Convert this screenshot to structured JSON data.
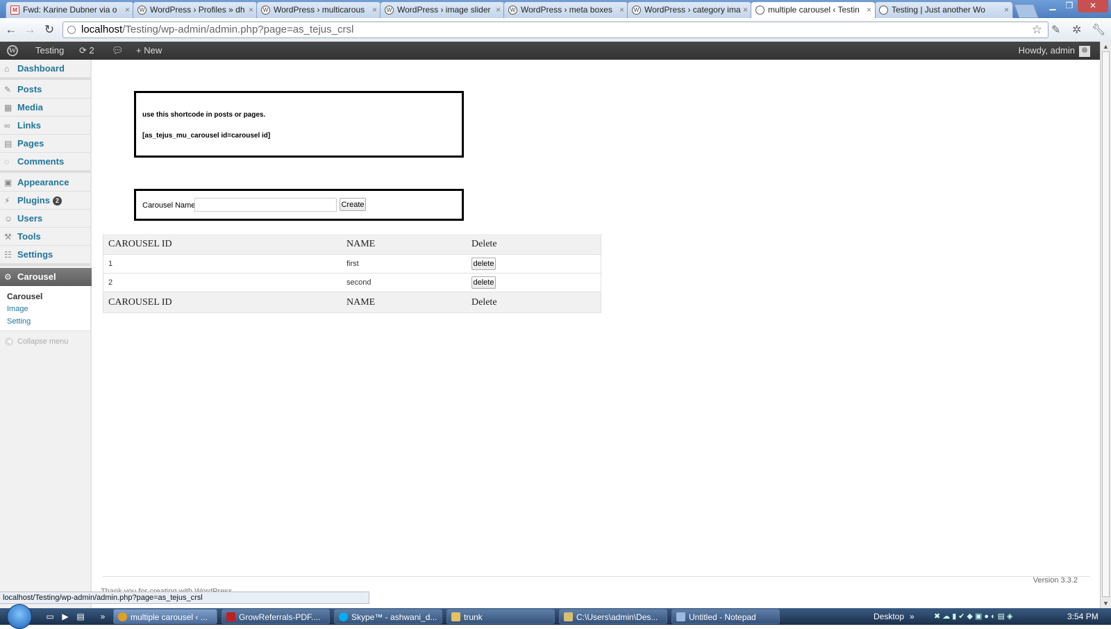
{
  "browser": {
    "tabs": [
      {
        "title": "Fwd: Karine Dubner via o",
        "icon": "gmail-icon"
      },
      {
        "title": "WordPress › Profiles » dh",
        "icon": "wordpress-icon"
      },
      {
        "title": "WordPress › multicarous",
        "icon": "wordpress-icon"
      },
      {
        "title": "WordPress › image slider",
        "icon": "wordpress-icon"
      },
      {
        "title": "WordPress › meta boxes",
        "icon": "wordpress-icon"
      },
      {
        "title": "WordPress › category ima",
        "icon": "wordpress-icon"
      },
      {
        "title": "multiple carousel ‹ Testin",
        "icon": "globe-icon",
        "active": true
      },
      {
        "title": "Testing | Just another Wo",
        "icon": "globe-icon"
      }
    ],
    "url_host": "localhost",
    "url_path": "/Testing/wp-admin/admin.php?page=as_tejus_crsl",
    "status_url": "localhost/Testing/wp-admin/admin.php?page=as_tejus_crsl"
  },
  "adminbar": {
    "site_name": "Testing",
    "updates_count": "2",
    "new_label": "New",
    "howdy": "Howdy, admin"
  },
  "sidebar": {
    "items": [
      {
        "label": "Dashboard",
        "icon": "dashboard-icon"
      },
      {
        "label": "Posts",
        "icon": "pin-icon"
      },
      {
        "label": "Media",
        "icon": "media-icon"
      },
      {
        "label": "Links",
        "icon": "link-icon"
      },
      {
        "label": "Pages",
        "icon": "page-icon"
      },
      {
        "label": "Comments",
        "icon": "comment-icon"
      },
      {
        "label": "Appearance",
        "icon": "appearance-icon"
      },
      {
        "label": "Plugins",
        "icon": "plugin-icon",
        "badge": "2"
      },
      {
        "label": "Users",
        "icon": "users-icon"
      },
      {
        "label": "Tools",
        "icon": "tools-icon"
      },
      {
        "label": "Settings",
        "icon": "settings-icon"
      }
    ],
    "current": {
      "label": "Carousel",
      "icon": "gear-icon"
    },
    "submenu": [
      "Carousel",
      "Image",
      "Setting"
    ],
    "collapse_label": "Collapse menu"
  },
  "main": {
    "shortcode_help": "use this shortcode in posts or pages.",
    "shortcode": "[as_tejus_mu_carousel id=carousel id]",
    "form": {
      "label": "Carousel Name",
      "value": "",
      "create_label": "Create"
    },
    "table": {
      "headers": [
        "CAROUSEL ID",
        "NAME",
        "Delete"
      ],
      "rows": [
        {
          "id": "1",
          "name": "first",
          "action": "delete"
        },
        {
          "id": "2",
          "name": "second",
          "action": "delete"
        }
      ]
    },
    "footer_peek": "Thank you for creating with WordPress.",
    "version": "Version 3.3.2"
  },
  "taskbar": {
    "buttons": [
      {
        "label": "multiple carousel ‹ ...",
        "active": true,
        "color": "#e0a020"
      },
      {
        "label": "GrowReferrals-PDF....",
        "color": "#c02020"
      },
      {
        "label": "Skype™ - ashwani_d...",
        "color": "#00aff0"
      },
      {
        "label": "trunk",
        "color": "#e8c060"
      },
      {
        "label": "C:\\Users\\admin\\Des...",
        "color": "#d8c070"
      },
      {
        "label": "Untitled - Notepad",
        "color": "#9ab8e0"
      }
    ],
    "desktop_label": "Desktop",
    "clock": "3:54 PM"
  },
  "colors": {
    "wp_link": "#21759b",
    "adminbar": "#464646",
    "taskbar": "#1b2f4a"
  }
}
